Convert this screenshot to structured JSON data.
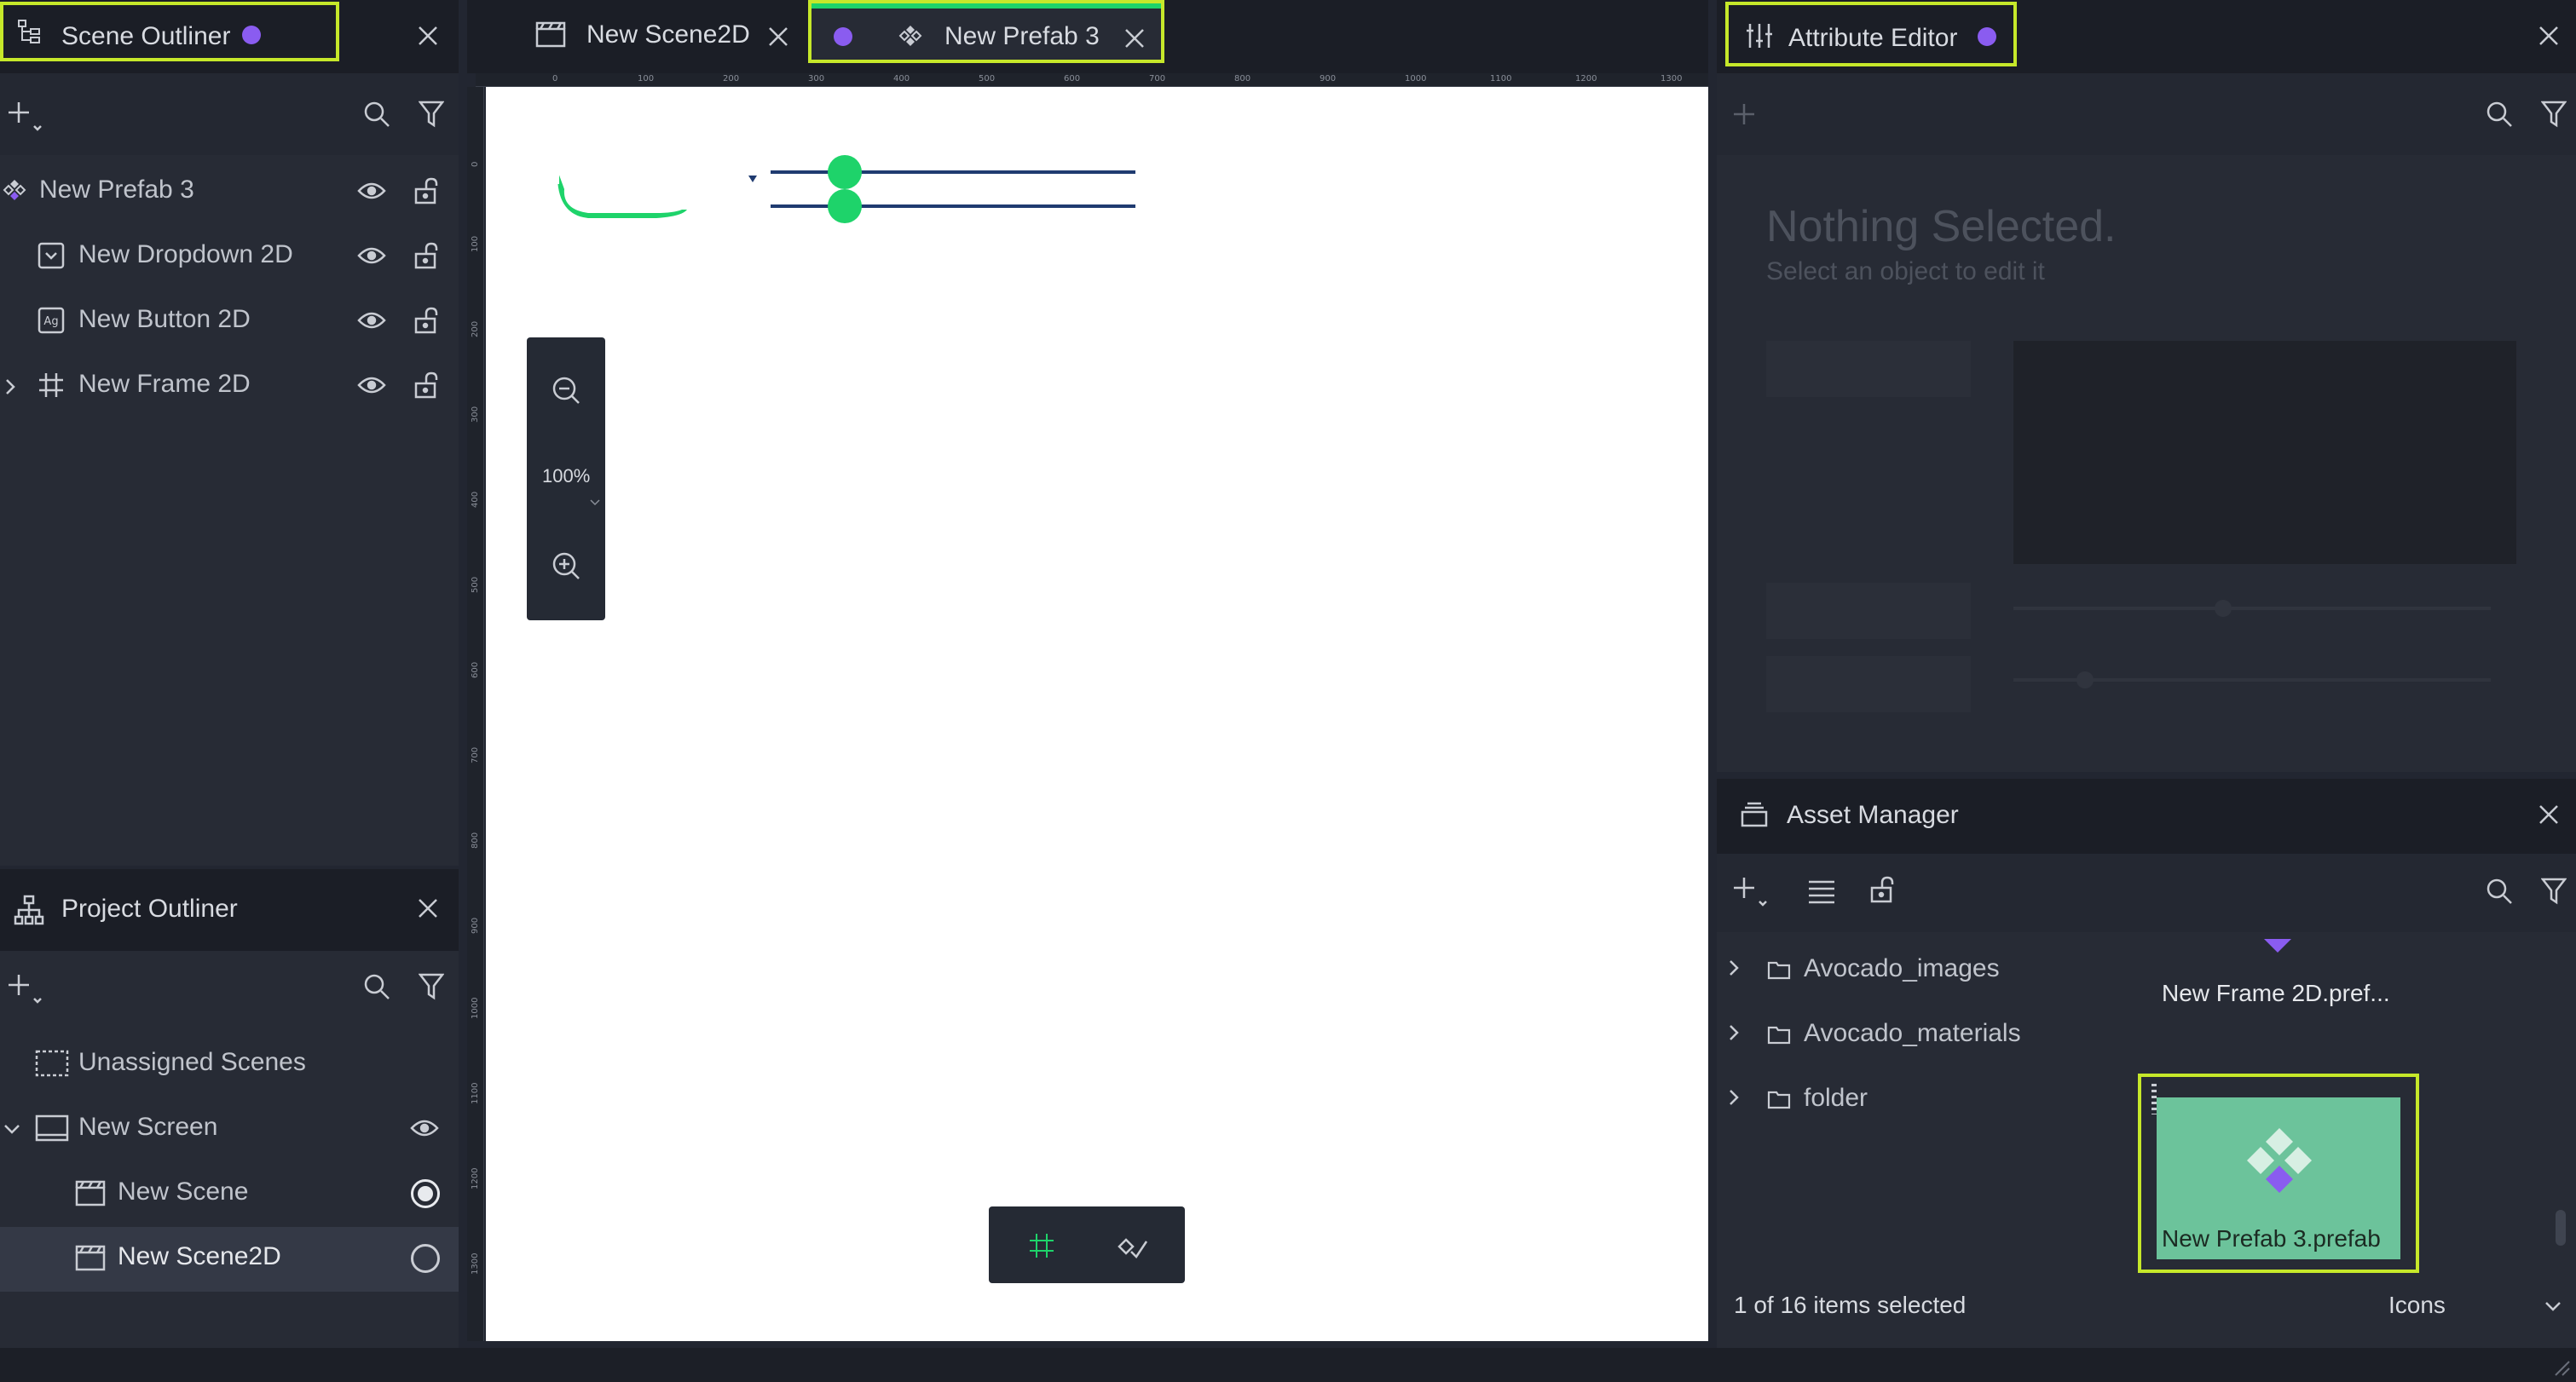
{
  "colors": {
    "accent_highlight": "#c6e82a",
    "purple_dot": "#8a5cf0",
    "green": "#1ed36a",
    "navy": "#1f3b70",
    "thumb": "#6cc39b"
  },
  "scene_outliner": {
    "title": "Scene Outliner",
    "items": [
      {
        "label": "New Prefab 3",
        "icon": "prefab-icon"
      },
      {
        "label": "New Dropdown 2D",
        "icon": "dropdown-icon"
      },
      {
        "label": "New Button 2D",
        "icon": "button-icon"
      },
      {
        "label": "New Frame 2D",
        "icon": "frame-icon"
      }
    ]
  },
  "project_outliner": {
    "title": "Project Outliner",
    "items": [
      {
        "label": "Unassigned Scenes"
      },
      {
        "label": "New Screen"
      },
      {
        "label": "New Scene"
      },
      {
        "label": "New Scene2D"
      }
    ]
  },
  "tabs": [
    {
      "label": "New Scene2D"
    },
    {
      "label": "New Prefab 3"
    }
  ],
  "ruler": {
    "top_ticks": [
      "0",
      "100",
      "200",
      "300",
      "400",
      "500",
      "600",
      "700",
      "800",
      "900",
      "1000",
      "1100",
      "1200",
      "1300"
    ],
    "left_ticks": [
      "0",
      "100",
      "200",
      "300",
      "400",
      "500",
      "600",
      "700",
      "800",
      "900",
      "1000",
      "1100",
      "1200",
      "1300"
    ]
  },
  "zoom": {
    "value": "100%"
  },
  "attribute_editor": {
    "title": "Attribute Editor",
    "empty_title": "Nothing Selected.",
    "empty_subtitle": "Select an object to edit it"
  },
  "asset_manager": {
    "title": "Asset Manager",
    "folders": [
      {
        "label": "Avocado_images"
      },
      {
        "label": "Avocado_materials"
      },
      {
        "label": "folder"
      }
    ],
    "assets": [
      {
        "label": "New Frame 2D.pref..."
      },
      {
        "label": "New Prefab 3.prefab"
      }
    ],
    "status": "1 of 16 items selected",
    "view_mode": "Icons"
  }
}
